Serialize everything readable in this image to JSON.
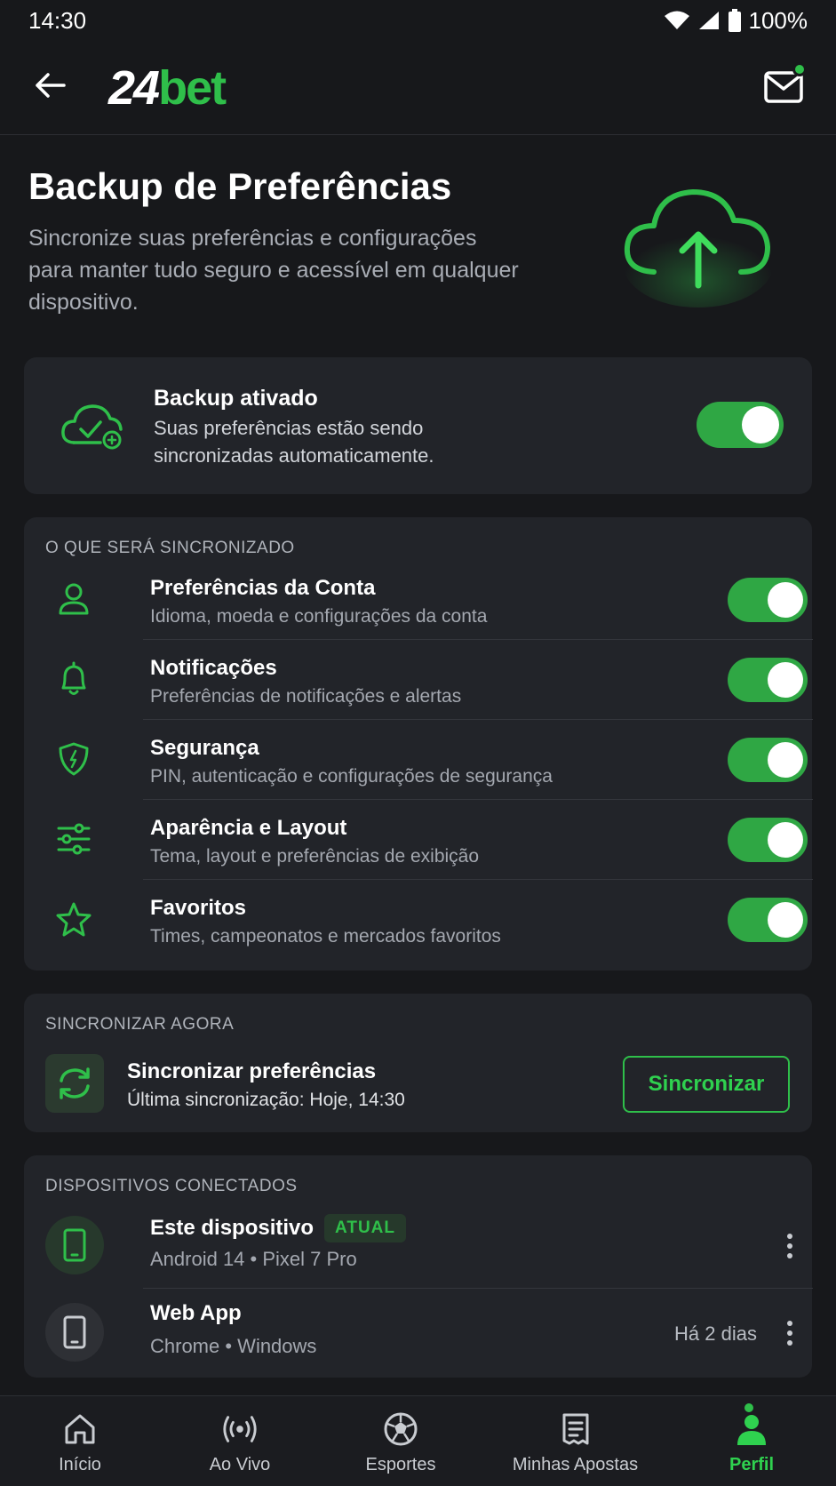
{
  "status_bar": {
    "time": "14:30",
    "battery": "100%"
  },
  "header": {
    "logo_white": "24",
    "logo_green": "bet"
  },
  "hero": {
    "title": "Backup de Preferências",
    "description": "Sincronize suas preferências e configurações para manter tudo seguro e acessível em qualquer dispositivo."
  },
  "backup": {
    "title": "Backup ativado",
    "description": "Suas preferências estão sendo sincronizadas automaticamente.",
    "enabled": true
  },
  "sync_items": {
    "section_label": "O QUE SERÁ SINCRONIZADO",
    "items": [
      {
        "title": "Preferências da Conta",
        "subtitle": "Idioma, moeda e configurações da conta",
        "icon": "user-icon",
        "enabled": true
      },
      {
        "title": "Notificações",
        "subtitle": "Preferências de notificações e alertas",
        "icon": "bell-icon",
        "enabled": true
      },
      {
        "title": "Segurança",
        "subtitle": "PIN, autenticação e configurações de segurança",
        "icon": "shield-icon",
        "enabled": true
      },
      {
        "title": "Aparência e Layout",
        "subtitle": "Tema, layout e preferências de exibição",
        "icon": "sliders-icon",
        "enabled": true
      },
      {
        "title": "Favoritos",
        "subtitle": "Times, campeonatos e mercados favoritos",
        "icon": "star-icon",
        "enabled": true
      }
    ]
  },
  "sync_now": {
    "section_label": "SINCRONIZAR AGORA",
    "title": "Sincronizar preferências",
    "subtitle": "Última sincronização: Hoje, 14:30",
    "button_label": "Sincronizar"
  },
  "devices": {
    "section_label": "DISPOSITIVOS CONECTADOS",
    "items": [
      {
        "title": "Este dispositivo",
        "badge": "ATUAL",
        "subtitle": "Android 14 • Pixel 7 Pro",
        "when": ""
      },
      {
        "title": "Web App",
        "badge": "",
        "subtitle": "Chrome • Windows",
        "when": "Há 2 dias"
      }
    ]
  },
  "bottom_nav": {
    "items": [
      {
        "label": "Início",
        "icon": "home-icon"
      },
      {
        "label": "Ao Vivo",
        "icon": "live-icon"
      },
      {
        "label": "Esportes",
        "icon": "soccer-ball-icon"
      },
      {
        "label": "Minhas Apostas",
        "icon": "receipt-icon"
      },
      {
        "label": "Perfil",
        "icon": "profile-icon",
        "active": true
      }
    ]
  },
  "colors": {
    "accent": "#2fbf4a",
    "background": "#17181b",
    "card": "#222429"
  }
}
